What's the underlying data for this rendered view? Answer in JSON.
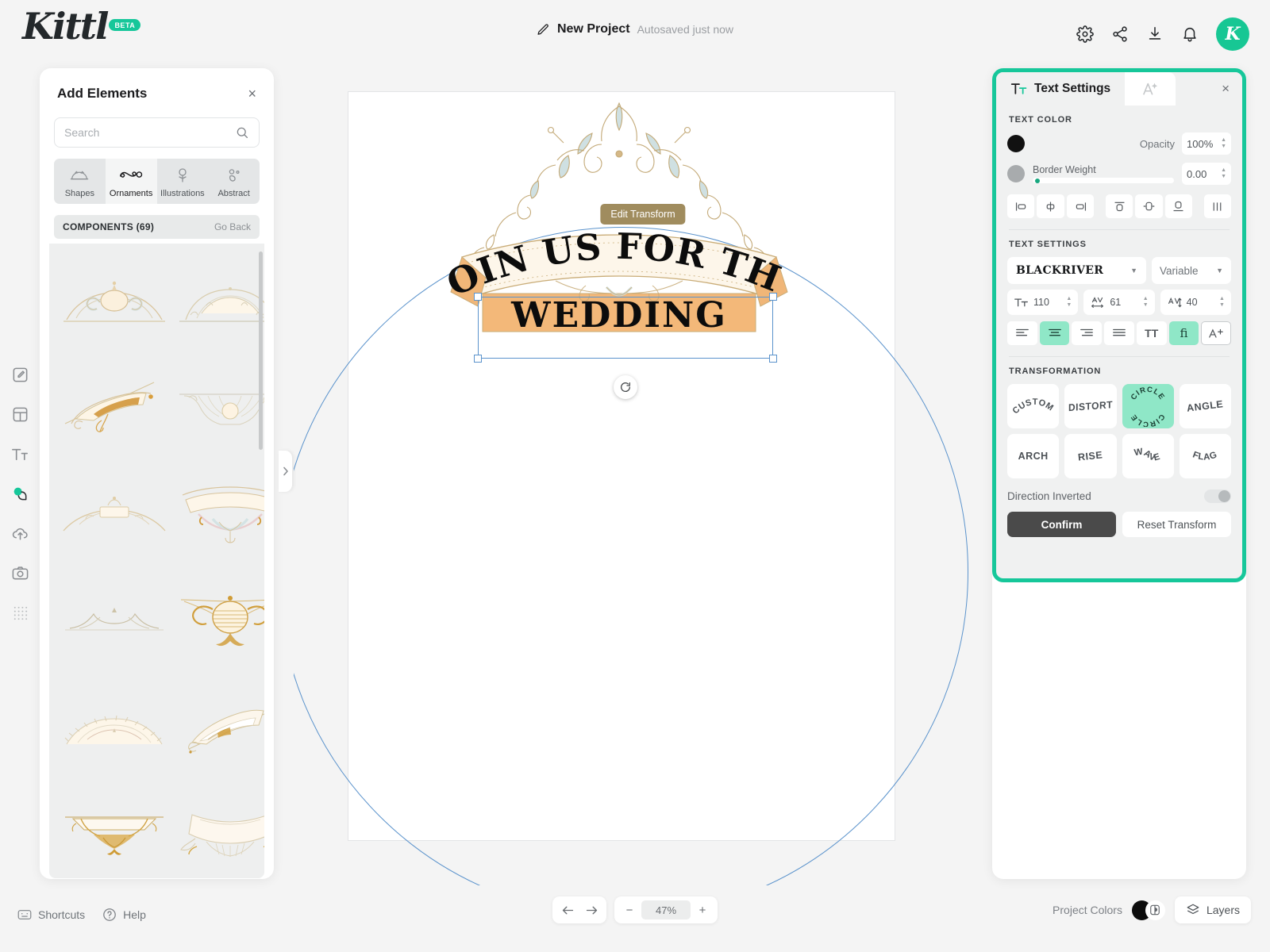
{
  "app": {
    "logo": "Kittl",
    "logo_badge": "BETA",
    "avatar_letter": "K",
    "accent": "#16c79a"
  },
  "header": {
    "project_name": "New Project",
    "autosave_status": "Autosaved just now",
    "icons": [
      "gear-icon",
      "share-icon",
      "download-icon",
      "bell-icon"
    ]
  },
  "left_rail": {
    "items": [
      {
        "name": "edit-icon",
        "active": false
      },
      {
        "name": "templates-icon",
        "active": false
      },
      {
        "name": "text-icon",
        "active": false
      },
      {
        "name": "elements-icon",
        "active": true
      },
      {
        "name": "upload-icon",
        "active": false
      },
      {
        "name": "photos-icon",
        "active": false
      },
      {
        "name": "grid-icon",
        "active": false
      }
    ]
  },
  "add_elements": {
    "title": "Add Elements",
    "close": "×",
    "search": {
      "value": "",
      "placeholder": "Search"
    },
    "categories": [
      {
        "label": "Shapes",
        "icon": "shapes-icon",
        "selected": false
      },
      {
        "label": "Ornaments",
        "icon": "ornaments-icon",
        "selected": true
      },
      {
        "label": "Illustrations",
        "icon": "illustrations-icon",
        "selected": false
      },
      {
        "label": "Abstract",
        "icon": "abstract-icon",
        "selected": false
      }
    ],
    "components_header": "COMPONENTS (69)",
    "go_back": "Go Back",
    "thumbnails": [
      "crown-ornament-with-oval-frame",
      "arched-lace-banner",
      "diagonal-ribbon-scroll",
      "fan-ornament-with-circle",
      "simple-arched-crown",
      "canopy-ornament-with-flourish",
      "small-scroll-flourish",
      "winged-oval-medallion",
      "scalloped-arch-banner",
      "diagonal-pennant-ribbon",
      "framed-label-with-flourish",
      "curved-banner-ribbon"
    ]
  },
  "canvas": {
    "edit_transform_label": "Edit Transform",
    "artwork": {
      "line1": "JOIN US FOR THE",
      "line2": "WEDDING"
    },
    "rotate_handle": "rotate-handle"
  },
  "right_panel": {
    "tab_title": "Text Settings",
    "tab_icon": "text-settings-icon",
    "second_tab_icon": "effects-icon",
    "close": "×",
    "text_color": {
      "label": "TEXT COLOR",
      "swatch": "#111111",
      "opacity_label": "Opacity",
      "opacity_value": "100%",
      "border_swatch": "#a8abad",
      "border_weight_label": "Border Weight",
      "border_weight_value": "0.00"
    },
    "align_icons": [
      "align-left-icon",
      "align-center-horizontal-icon",
      "align-right-icon",
      "align-top-icon",
      "align-middle-vertical-icon",
      "align-bottom-icon",
      "distribute-icon"
    ],
    "text_settings": {
      "label": "TEXT SETTINGS",
      "font_family": "BLACKRIVER",
      "font_variant": "Variable",
      "font_size": "110",
      "letter_spacing": "61",
      "line_height": "40",
      "size_icon": "font-size-icon",
      "tracking_icon": "letter-spacing-icon",
      "leading_icon": "line-height-icon",
      "paragraph_buttons": [
        {
          "name": "align-text-left-icon",
          "active": false
        },
        {
          "name": "align-text-center-icon",
          "active": true
        },
        {
          "name": "align-text-right-icon",
          "active": false
        },
        {
          "name": "align-text-justify-icon",
          "active": false
        },
        {
          "name": "uppercase-icon",
          "label": "TT",
          "active": false
        },
        {
          "name": "ligature-icon",
          "label": "fi",
          "active": true
        },
        {
          "name": "add-font-icon",
          "label": "A+",
          "active": false,
          "outlined": true
        }
      ]
    },
    "transformation": {
      "label": "TRANSFORMATION",
      "options": [
        {
          "label": "CUSTOM",
          "style": "arc",
          "active": false
        },
        {
          "label": "DISTORT",
          "style": "tilt",
          "active": false
        },
        {
          "label": "CIRCLE",
          "style": "circle",
          "active": true
        },
        {
          "label": "ANGLE",
          "style": "angle",
          "active": false
        },
        {
          "label": "ARCH",
          "style": "arch",
          "active": false
        },
        {
          "label": "RISE",
          "style": "rise",
          "active": false
        },
        {
          "label": "WAVE",
          "style": "wave",
          "active": false
        },
        {
          "label": "FLAG",
          "style": "flag",
          "active": false
        }
      ],
      "direction_inverted_label": "Direction Inverted",
      "direction_inverted_on": false,
      "confirm_label": "Confirm",
      "reset_label": "Reset Transform"
    }
  },
  "footer": {
    "shortcuts_label": "Shortcuts",
    "help_label": "Help",
    "undo_icon": "undo-icon",
    "redo_icon": "redo-icon",
    "zoom_out": "−",
    "zoom_value": "47%",
    "zoom_in": "+",
    "project_colors_label": "Project Colors",
    "layers_label": "Layers"
  }
}
